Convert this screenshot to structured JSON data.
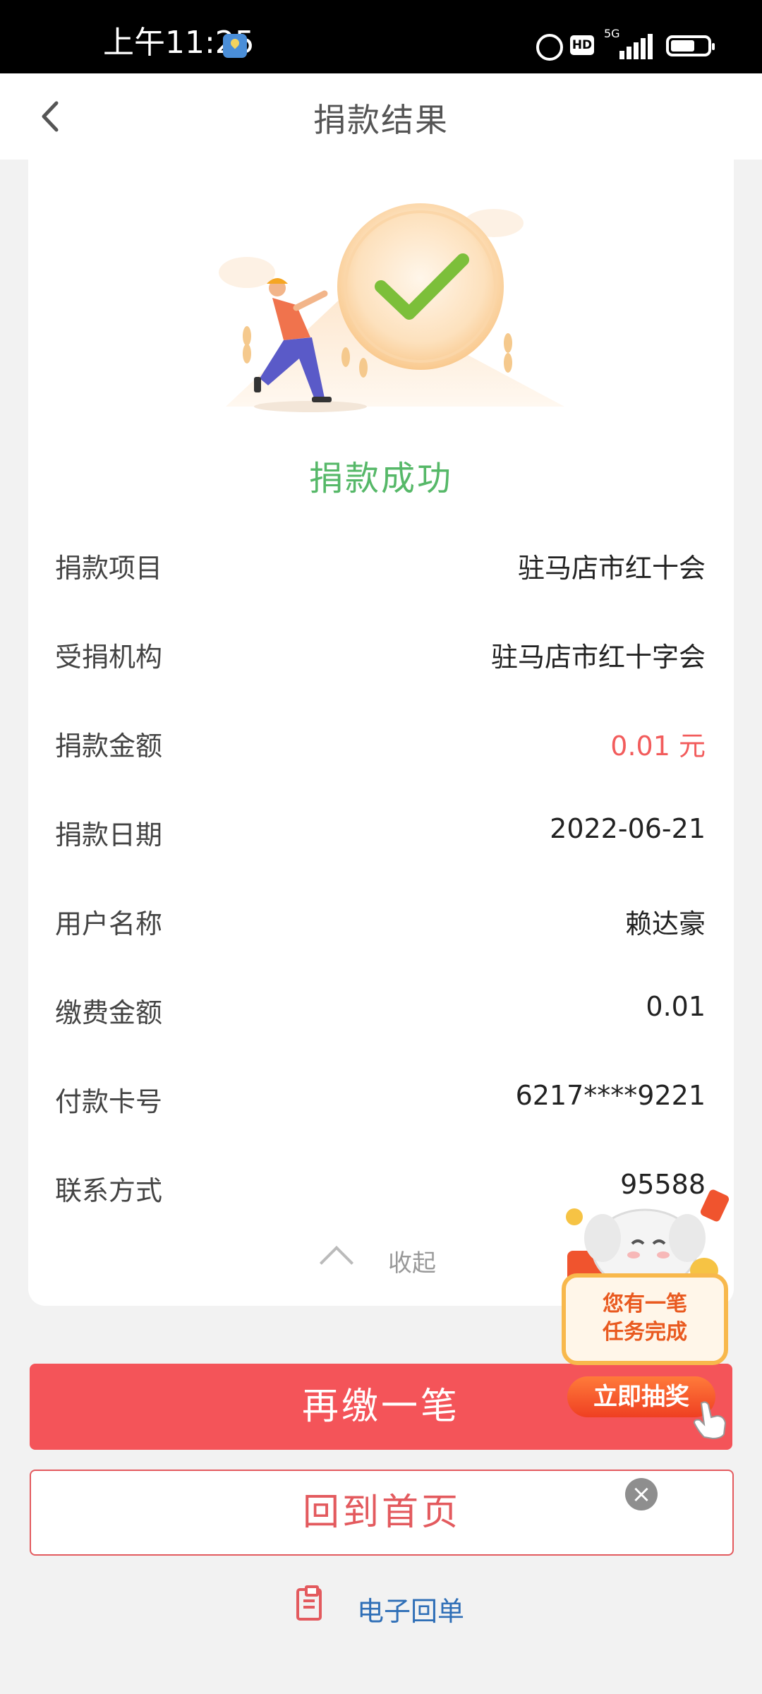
{
  "status_bar": {
    "time": "上午11:25",
    "network": "5G",
    "hd": "HD"
  },
  "header": {
    "title": "捐款结果"
  },
  "result": {
    "title": "捐款成功",
    "rows": [
      {
        "label": "捐款项目",
        "value": "驻马店市红十会"
      },
      {
        "label": "受捐机构",
        "value": "驻马店市红十字会"
      },
      {
        "label": "捐款金额",
        "value": "0.01 元",
        "highlight": "#f25c5c"
      },
      {
        "label": "捐款日期",
        "value": "2022-06-21"
      },
      {
        "label": "用户名称",
        "value": "赖达豪"
      },
      {
        "label": "缴费金额",
        "value": "0.01"
      },
      {
        "label": "付款卡号",
        "value": "6217****9221"
      },
      {
        "label": "联系方式",
        "value": "95588"
      }
    ],
    "collapse_label": "收起"
  },
  "actions": {
    "again_label": "再缴一笔",
    "home_label": "回到首页",
    "receipt_label": "电子回单"
  },
  "promo": {
    "text_line1": "您有一笔",
    "text_line2": "任务完成",
    "button_label": "立即抽奖",
    "close_glyph": "×"
  },
  "colors": {
    "accent_red": "#f45459",
    "success_green": "#56b868",
    "link_blue": "#2f6fb7"
  }
}
